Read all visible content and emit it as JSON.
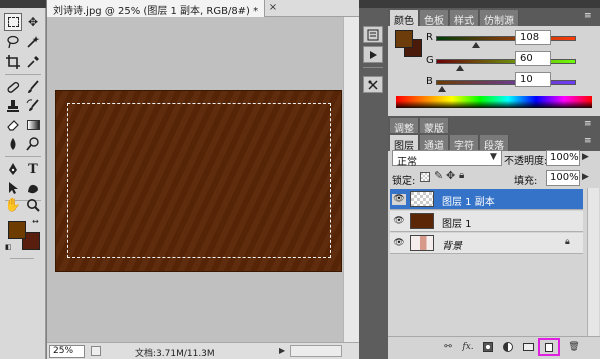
{
  "document": {
    "tab_title": "刘诗诗.jpg @ 25% (图层 1 副本, RGB/8#) *",
    "close_glyph": "×",
    "canvas_color": "#5a2606",
    "zoom_value": "25%",
    "doc_size": "文档:3.71M/11.3M"
  },
  "toolbox": {
    "tools": [
      "marquee-icon",
      "move-icon",
      "lasso-icon",
      "magic-wand-icon",
      "crop-icon",
      "eyedropper-icon",
      "healing-icon",
      "brush-icon",
      "stamp-icon",
      "history-brush-icon",
      "eraser-icon",
      "gradient-icon",
      "dodge-icon",
      "blur-icon",
      "pen-icon",
      "text-icon",
      "path-select-icon",
      "shape-icon",
      "hand-icon",
      "zoom-icon"
    ],
    "foreground_color": "#6c3c00",
    "background_color": "#5a1e0e"
  },
  "color_panel": {
    "tabs": [
      "颜色",
      "色板",
      "样式",
      "仿制源"
    ],
    "r_label": "R",
    "g_label": "G",
    "b_label": "B",
    "r_value": "108",
    "g_value": "60",
    "b_value": "10",
    "swatch_fg": "#6c3c0a",
    "swatch_bg": "#4a1a0a"
  },
  "adjust_tabs": [
    "调整",
    "蒙版"
  ],
  "layers_panel": {
    "tabs": [
      "图层",
      "通道",
      "字符",
      "段落"
    ],
    "blend_mode": "正常",
    "opacity_label": "不透明度:",
    "opacity_value": "100%",
    "lock_label": "锁定:",
    "fill_label": "填充:",
    "fill_value": "100%",
    "layers": [
      {
        "name": "图层 1 副本",
        "selected": true
      },
      {
        "name": "图层 1",
        "selected": false
      },
      {
        "name": "背景",
        "selected": false
      }
    ],
    "bottom_icons": [
      "link-icon",
      "fx-icon",
      "mask-icon",
      "adjustment-icon",
      "group-icon",
      "new-layer-icon",
      "trash-icon"
    ]
  }
}
